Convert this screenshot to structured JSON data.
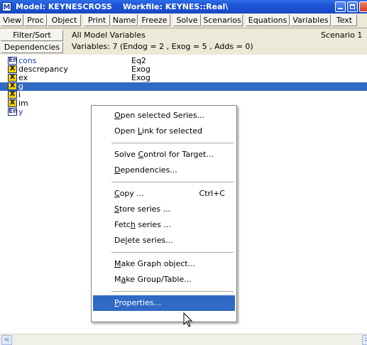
{
  "window": {
    "app_icon_letter": "M",
    "title": "Model: KEYNESCROSS    Workfile: KEYNES::Real\\"
  },
  "toolbar": [
    "View",
    "Proc",
    "Object",
    "Print",
    "Name",
    "Freeze",
    "Solve",
    "Scenarios",
    "Equations",
    "Variables",
    "Text"
  ],
  "info": {
    "filter_button": "Filter/Sort",
    "dependencies_button": "Dependencies",
    "line1": "All Model Variables",
    "line2": "Variables: 7  (Endog = 2 , Exog = 5 , Adds = 0)",
    "scenario": "Scenario 1"
  },
  "variables": [
    {
      "badge": "En",
      "kind": "endog",
      "name": "cons",
      "type": "Eq2",
      "selected": false
    },
    {
      "badge": "X",
      "kind": "exog",
      "name": "descrepancy",
      "type": "Exog",
      "selected": false
    },
    {
      "badge": "X",
      "kind": "exog",
      "name": "ex",
      "type": "Exog",
      "selected": false
    },
    {
      "badge": "X",
      "kind": "exog",
      "name": "g",
      "type": "",
      "selected": true
    },
    {
      "badge": "X",
      "kind": "exog",
      "name": "i",
      "type": "",
      "selected": false
    },
    {
      "badge": "X",
      "kind": "exog",
      "name": "im",
      "type": "",
      "selected": false
    },
    {
      "badge": "En",
      "kind": "endog",
      "name": "y",
      "type": "",
      "selected": false
    }
  ],
  "context_menu": {
    "items": [
      {
        "pre": "",
        "u": "O",
        "post": "pen selected Series...",
        "shortcut": ""
      },
      {
        "pre": "Open ",
        "u": "L",
        "post": "ink for selected",
        "shortcut": ""
      },
      {
        "sep": true
      },
      {
        "pre": "Solve ",
        "u": "C",
        "post": "ontrol for Target...",
        "shortcut": ""
      },
      {
        "pre": "",
        "u": "D",
        "post": "ependencies...",
        "shortcut": ""
      },
      {
        "sep": true
      },
      {
        "pre": "",
        "u": "C",
        "post": "opy ...",
        "shortcut": "Ctrl+C"
      },
      {
        "pre": "",
        "u": "S",
        "post": "tore series ...",
        "shortcut": ""
      },
      {
        "pre": "Fetc",
        "u": "h",
        "post": " series ...",
        "shortcut": ""
      },
      {
        "pre": "De",
        "u": "l",
        "post": "ete series...",
        "shortcut": ""
      },
      {
        "sep": true
      },
      {
        "pre": "",
        "u": "M",
        "post": "ake Graph object...",
        "shortcut": ""
      },
      {
        "pre": "M",
        "u": "a",
        "post": "ke Group/Table...",
        "shortcut": ""
      },
      {
        "sep": true
      },
      {
        "pre": "",
        "u": "P",
        "post": "roperties...",
        "shortcut": "",
        "hover": true
      }
    ]
  },
  "scrollbar": {
    "left_arrow": "<",
    "right_arrow": ">"
  }
}
